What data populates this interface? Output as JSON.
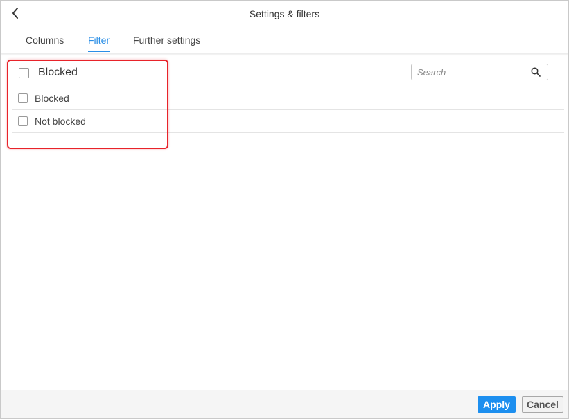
{
  "dialog": {
    "title": "Settings & filters",
    "back_icon": "chevron-left-icon"
  },
  "tabs": [
    {
      "label": "Columns",
      "active": false
    },
    {
      "label": "Filter",
      "active": true
    },
    {
      "label": "Further settings",
      "active": false
    }
  ],
  "filter": {
    "group_title": "Blocked",
    "group_checked": false,
    "options": [
      {
        "label": "Blocked",
        "checked": false
      },
      {
        "label": "Not blocked",
        "checked": false
      }
    ]
  },
  "search": {
    "placeholder": "Search",
    "value": "",
    "icon": "search-icon"
  },
  "footer": {
    "apply_label": "Apply",
    "cancel_label": "Cancel"
  },
  "colors": {
    "accent": "#1d8fef",
    "highlight": "#e8232a",
    "active_tab": "#2a8ee6"
  }
}
